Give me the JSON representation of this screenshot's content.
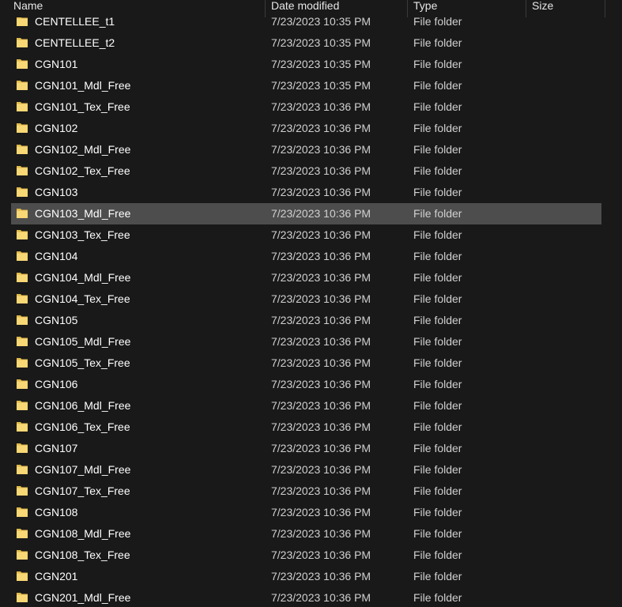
{
  "columns": {
    "name": "Name",
    "date": "Date modified",
    "type": "Type",
    "size": "Size"
  },
  "colors": {
    "background": "#191919",
    "selected_row": "#4d4d4d",
    "folder_yellow": "#f8d775",
    "folder_dark": "#e0b94a"
  },
  "selected_index": 9,
  "rows": [
    {
      "name": "CENTELLEE_t1",
      "date": "7/23/2023 10:35 PM",
      "type": "File folder",
      "size": "",
      "icon": "folder-icon"
    },
    {
      "name": "CENTELLEE_t2",
      "date": "7/23/2023 10:35 PM",
      "type": "File folder",
      "size": "",
      "icon": "folder-icon"
    },
    {
      "name": "CGN101",
      "date": "7/23/2023 10:35 PM",
      "type": "File folder",
      "size": "",
      "icon": "folder-icon"
    },
    {
      "name": "CGN101_Mdl_Free",
      "date": "7/23/2023 10:35 PM",
      "type": "File folder",
      "size": "",
      "icon": "folder-icon"
    },
    {
      "name": "CGN101_Tex_Free",
      "date": "7/23/2023 10:36 PM",
      "type": "File folder",
      "size": "",
      "icon": "folder-icon"
    },
    {
      "name": "CGN102",
      "date": "7/23/2023 10:36 PM",
      "type": "File folder",
      "size": "",
      "icon": "folder-icon"
    },
    {
      "name": "CGN102_Mdl_Free",
      "date": "7/23/2023 10:36 PM",
      "type": "File folder",
      "size": "",
      "icon": "folder-icon"
    },
    {
      "name": "CGN102_Tex_Free",
      "date": "7/23/2023 10:36 PM",
      "type": "File folder",
      "size": "",
      "icon": "folder-icon"
    },
    {
      "name": "CGN103",
      "date": "7/23/2023 10:36 PM",
      "type": "File folder",
      "size": "",
      "icon": "folder-icon"
    },
    {
      "name": "CGN103_Mdl_Free",
      "date": "7/23/2023 10:36 PM",
      "type": "File folder",
      "size": "",
      "icon": "folder-icon"
    },
    {
      "name": "CGN103_Tex_Free",
      "date": "7/23/2023 10:36 PM",
      "type": "File folder",
      "size": "",
      "icon": "folder-icon"
    },
    {
      "name": "CGN104",
      "date": "7/23/2023 10:36 PM",
      "type": "File folder",
      "size": "",
      "icon": "folder-icon"
    },
    {
      "name": "CGN104_Mdl_Free",
      "date": "7/23/2023 10:36 PM",
      "type": "File folder",
      "size": "",
      "icon": "folder-icon"
    },
    {
      "name": "CGN104_Tex_Free",
      "date": "7/23/2023 10:36 PM",
      "type": "File folder",
      "size": "",
      "icon": "folder-icon"
    },
    {
      "name": "CGN105",
      "date": "7/23/2023 10:36 PM",
      "type": "File folder",
      "size": "",
      "icon": "folder-icon"
    },
    {
      "name": "CGN105_Mdl_Free",
      "date": "7/23/2023 10:36 PM",
      "type": "File folder",
      "size": "",
      "icon": "folder-icon"
    },
    {
      "name": "CGN105_Tex_Free",
      "date": "7/23/2023 10:36 PM",
      "type": "File folder",
      "size": "",
      "icon": "folder-icon"
    },
    {
      "name": "CGN106",
      "date": "7/23/2023 10:36 PM",
      "type": "File folder",
      "size": "",
      "icon": "folder-icon"
    },
    {
      "name": "CGN106_Mdl_Free",
      "date": "7/23/2023 10:36 PM",
      "type": "File folder",
      "size": "",
      "icon": "folder-icon"
    },
    {
      "name": "CGN106_Tex_Free",
      "date": "7/23/2023 10:36 PM",
      "type": "File folder",
      "size": "",
      "icon": "folder-icon"
    },
    {
      "name": "CGN107",
      "date": "7/23/2023 10:36 PM",
      "type": "File folder",
      "size": "",
      "icon": "folder-icon"
    },
    {
      "name": "CGN107_Mdl_Free",
      "date": "7/23/2023 10:36 PM",
      "type": "File folder",
      "size": "",
      "icon": "folder-icon"
    },
    {
      "name": "CGN107_Tex_Free",
      "date": "7/23/2023 10:36 PM",
      "type": "File folder",
      "size": "",
      "icon": "folder-icon"
    },
    {
      "name": "CGN108",
      "date": "7/23/2023 10:36 PM",
      "type": "File folder",
      "size": "",
      "icon": "folder-icon"
    },
    {
      "name": "CGN108_Mdl_Free",
      "date": "7/23/2023 10:36 PM",
      "type": "File folder",
      "size": "",
      "icon": "folder-icon"
    },
    {
      "name": "CGN108_Tex_Free",
      "date": "7/23/2023 10:36 PM",
      "type": "File folder",
      "size": "",
      "icon": "folder-icon"
    },
    {
      "name": "CGN201",
      "date": "7/23/2023 10:36 PM",
      "type": "File folder",
      "size": "",
      "icon": "folder-icon"
    },
    {
      "name": "CGN201_Mdl_Free",
      "date": "7/23/2023 10:36 PM",
      "type": "File folder",
      "size": "",
      "icon": "folder-icon"
    }
  ]
}
